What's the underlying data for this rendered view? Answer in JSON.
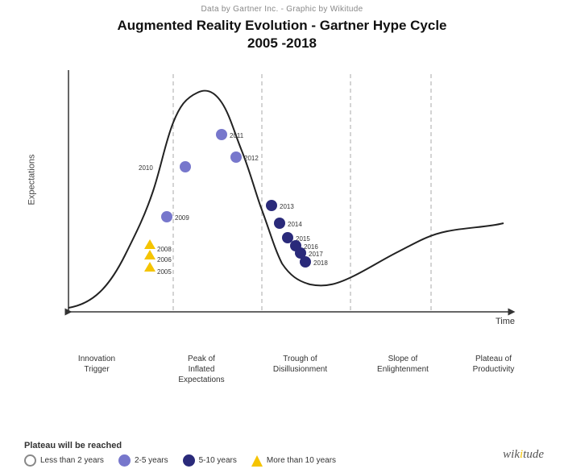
{
  "credit": "Data by Gartner Inc.  -  Graphic by Wikitude",
  "title_line1": "Augmented Reality Evolution - Gartner Hype Cycle",
  "title_line2": "2005 -2018",
  "y_axis_label": "Expectations",
  "x_axis_label": "Time",
  "phases": [
    {
      "label": "Innovation\nTrigger",
      "x_pct": 8
    },
    {
      "label": "Peak of\nInflated\nExpectations",
      "x_pct": 26
    },
    {
      "label": "Trough of\nDisillusionment",
      "x_pct": 44
    },
    {
      "label": "Slope of Enlightenment",
      "x_pct": 62
    },
    {
      "label": "Plateau of\nProductivity",
      "x_pct": 80
    }
  ],
  "data_points": [
    {
      "year": "2005",
      "x_pct": 22,
      "y_pct": 68,
      "type": "triangle"
    },
    {
      "year": "2006",
      "x_pct": 22,
      "y_pct": 62,
      "type": "triangle"
    },
    {
      "year": "2008",
      "x_pct": 22,
      "y_pct": 57,
      "type": "triangle"
    },
    {
      "year": "2009",
      "x_pct": 26,
      "y_pct": 46,
      "type": "medium"
    },
    {
      "year": "2010",
      "x_pct": 30,
      "y_pct": 28,
      "type": "medium"
    },
    {
      "year": "2011",
      "x_pct": 38,
      "y_pct": 18,
      "type": "medium"
    },
    {
      "year": "2012",
      "x_pct": 41,
      "y_pct": 27,
      "type": "medium"
    },
    {
      "year": "2013",
      "x_pct": 48,
      "y_pct": 52,
      "type": "dark"
    },
    {
      "year": "2014",
      "x_pct": 50,
      "y_pct": 60,
      "type": "dark"
    },
    {
      "year": "2015",
      "x_pct": 52,
      "y_pct": 66,
      "type": "dark"
    },
    {
      "year": "2016",
      "x_pct": 54,
      "y_pct": 70,
      "type": "dark"
    },
    {
      "year": "2017",
      "x_pct": 55,
      "y_pct": 72,
      "type": "dark"
    },
    {
      "year": "2018",
      "x_pct": 56,
      "y_pct": 76,
      "type": "dark"
    }
  ],
  "legend": {
    "title": "Plateau will be reached",
    "items": [
      {
        "symbol": "circle-empty",
        "label": "Less than 2 years"
      },
      {
        "symbol": "circle-medium",
        "label": "2-5 years"
      },
      {
        "symbol": "circle-dark",
        "label": "5-10 years"
      },
      {
        "symbol": "triangle",
        "label": "More than 10 years"
      }
    ]
  },
  "wikitude": "wikitude"
}
